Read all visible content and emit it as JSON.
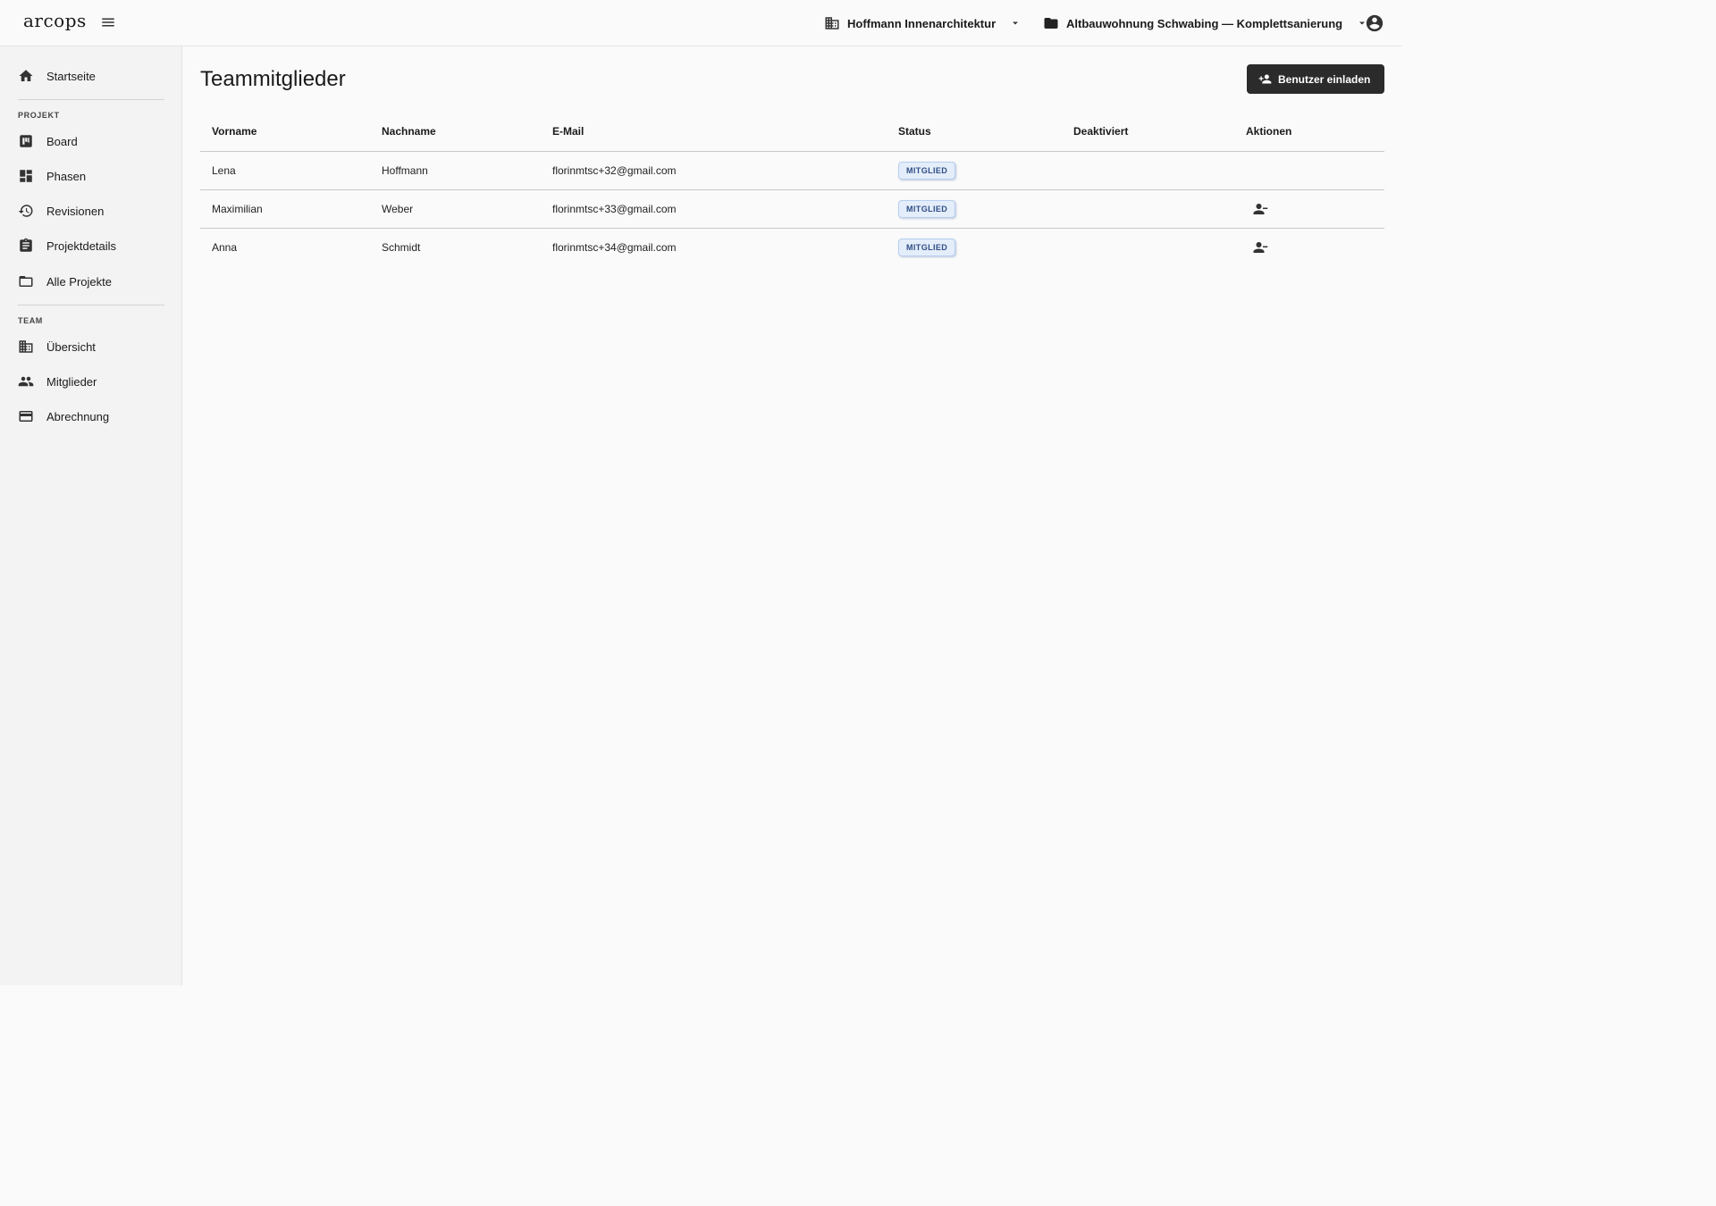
{
  "app": {
    "logo": "arcops"
  },
  "header": {
    "org_selector": {
      "label": "Hoffmann Innenarchitektur",
      "icon": "building-icon"
    },
    "project_selector": {
      "label": "Altbauwohnung Schwabing — Komplettsanierung",
      "icon": "folder-icon"
    },
    "account_icon": "account-circle-icon"
  },
  "sidebar": {
    "home": {
      "label": "Startseite",
      "icon": "home-icon"
    },
    "project_section": "PROJEKT",
    "project_items": [
      {
        "label": "Board",
        "icon": "board-icon"
      },
      {
        "label": "Phasen",
        "icon": "dashboard-icon"
      },
      {
        "label": "Revisionen",
        "icon": "history-icon"
      },
      {
        "label": "Projektdetails",
        "icon": "clipboard-icon"
      },
      {
        "label": "Alle Projekte",
        "icon": "folder-outline-icon"
      }
    ],
    "team_section": "TEAM",
    "team_items": [
      {
        "label": "Übersicht",
        "icon": "building-icon"
      },
      {
        "label": "Mitglieder",
        "icon": "people-icon"
      },
      {
        "label": "Abrechnung",
        "icon": "credit-card-icon"
      }
    ]
  },
  "main": {
    "title": "Teammitglieder",
    "invite_button": "Benutzer einladen",
    "table": {
      "columns": [
        "Vorname",
        "Nachname",
        "E-Mail",
        "Status",
        "Deaktiviert",
        "Aktionen"
      ],
      "rows": [
        {
          "first_name": "Lena",
          "last_name": "Hoffmann",
          "email": "florinmtsc+32@gmail.com",
          "status": "MITGLIED",
          "deactivated": "",
          "remove_action": false
        },
        {
          "first_name": "Maximilian",
          "last_name": "Weber",
          "email": "florinmtsc+33@gmail.com",
          "status": "MITGLIED",
          "deactivated": "",
          "remove_action": true
        },
        {
          "first_name": "Anna",
          "last_name": "Schmidt",
          "email": "florinmtsc+34@gmail.com",
          "status": "MITGLIED",
          "deactivated": "",
          "remove_action": true
        }
      ]
    }
  },
  "colors": {
    "button_bg": "#2b2b2b",
    "badge_bg": "#e4edfa",
    "badge_text": "#2f4e85",
    "sidebar_bg": "#f3f3f3",
    "page_bg": "#fafafa"
  }
}
